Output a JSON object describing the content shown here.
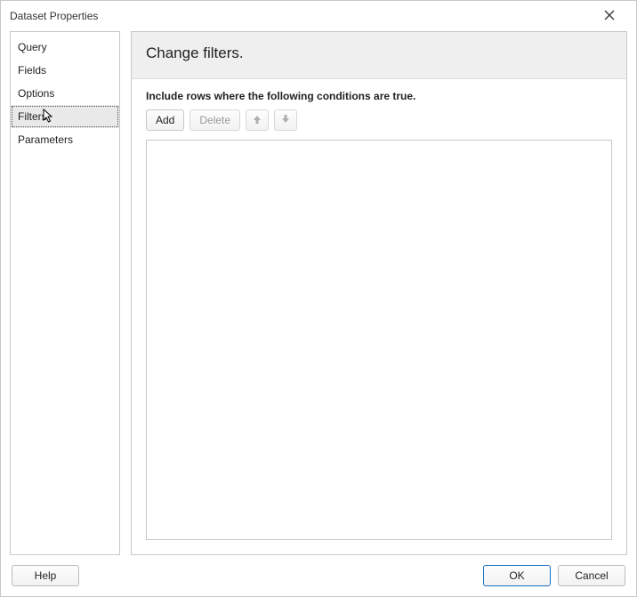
{
  "window": {
    "title": "Dataset Properties"
  },
  "sidebar": {
    "items": [
      {
        "label": "Query"
      },
      {
        "label": "Fields"
      },
      {
        "label": "Options"
      },
      {
        "label": "Filters"
      },
      {
        "label": "Parameters"
      }
    ],
    "selected_index": 3
  },
  "main": {
    "heading": "Change filters.",
    "instruction": "Include rows where the following conditions are true.",
    "toolbar": {
      "add_label": "Add",
      "delete_label": "Delete"
    }
  },
  "footer": {
    "help_label": "Help",
    "ok_label": "OK",
    "cancel_label": "Cancel"
  }
}
